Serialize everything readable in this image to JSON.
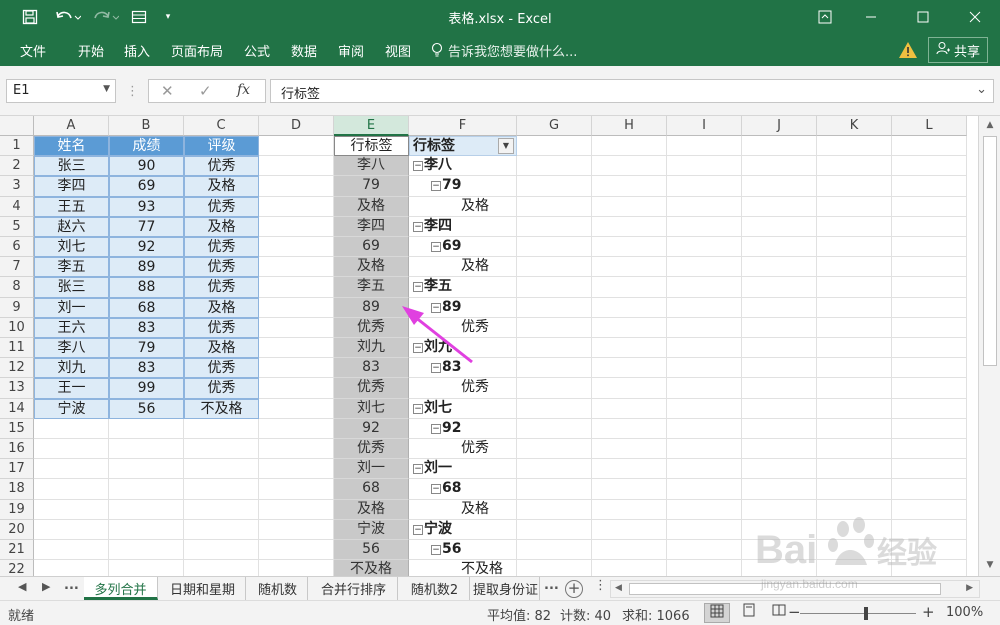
{
  "window": {
    "title": "表格.xlsx - Excel",
    "qa_icons": [
      "save-icon",
      "undo-icon",
      "redo-icon",
      "form-icon",
      "customize-icon"
    ]
  },
  "menu": {
    "items": [
      "文件",
      "开始",
      "插入",
      "页面布局",
      "公式",
      "数据",
      "审阅",
      "视图"
    ],
    "tell_me": "告诉我您想要做什么...",
    "share": "共享"
  },
  "formula_bar": {
    "name_box": "E1",
    "fx": "fx",
    "value": "行标签"
  },
  "columns": [
    "A",
    "B",
    "C",
    "D",
    "E",
    "F",
    "G",
    "H",
    "I",
    "J",
    "K",
    "L"
  ],
  "selected_column": "E",
  "rows": [
    "1",
    "2",
    "3",
    "4",
    "5",
    "6",
    "7",
    "8",
    "9",
    "10",
    "11",
    "12",
    "13",
    "14",
    "15",
    "16",
    "17",
    "18",
    "19",
    "20",
    "21",
    "22"
  ],
  "table": {
    "headers": [
      "姓名",
      "成绩",
      "评级"
    ],
    "rows": [
      [
        "张三",
        "90",
        "优秀"
      ],
      [
        "李四",
        "69",
        "及格"
      ],
      [
        "王五",
        "93",
        "优秀"
      ],
      [
        "赵六",
        "77",
        "及格"
      ],
      [
        "刘七",
        "92",
        "优秀"
      ],
      [
        "李五",
        "89",
        "优秀"
      ],
      [
        "张三",
        "88",
        "优秀"
      ],
      [
        "刘一",
        "68",
        "及格"
      ],
      [
        "王六",
        "83",
        "优秀"
      ],
      [
        "李八",
        "79",
        "及格"
      ],
      [
        "刘九",
        "83",
        "优秀"
      ],
      [
        "王一",
        "99",
        "优秀"
      ],
      [
        "宁波",
        "56",
        "不及格"
      ]
    ]
  },
  "column_e": [
    "行标签",
    "李八",
    "79",
    "及格",
    "李四",
    "69",
    "及格",
    "李五",
    "89",
    "优秀",
    "刘九",
    "83",
    "优秀",
    "刘七",
    "92",
    "优秀",
    "刘一",
    "68",
    "及格",
    "宁波",
    "56",
    "不及格"
  ],
  "pivot": {
    "header": "行标签",
    "rows": [
      {
        "level": 0,
        "text": "李八",
        "toggle": "⊟"
      },
      {
        "level": 1,
        "text": "79",
        "toggle": "⊟"
      },
      {
        "level": 2,
        "text": "及格",
        "toggle": ""
      },
      {
        "level": 0,
        "text": "李四",
        "toggle": "⊟"
      },
      {
        "level": 1,
        "text": "69",
        "toggle": "⊟"
      },
      {
        "level": 2,
        "text": "及格",
        "toggle": ""
      },
      {
        "level": 0,
        "text": "李五",
        "toggle": "⊟"
      },
      {
        "level": 1,
        "text": "89",
        "toggle": "⊟"
      },
      {
        "level": 2,
        "text": "优秀",
        "toggle": ""
      },
      {
        "level": 0,
        "text": "刘九",
        "toggle": "⊟"
      },
      {
        "level": 1,
        "text": "83",
        "toggle": "⊟"
      },
      {
        "level": 2,
        "text": "优秀",
        "toggle": ""
      },
      {
        "level": 0,
        "text": "刘七",
        "toggle": "⊟"
      },
      {
        "level": 1,
        "text": "92",
        "toggle": "⊟"
      },
      {
        "level": 2,
        "text": "优秀",
        "toggle": ""
      },
      {
        "level": 0,
        "text": "刘一",
        "toggle": "⊟"
      },
      {
        "level": 1,
        "text": "68",
        "toggle": "⊟"
      },
      {
        "level": 2,
        "text": "及格",
        "toggle": ""
      },
      {
        "level": 0,
        "text": "宁波",
        "toggle": "⊟"
      },
      {
        "level": 1,
        "text": "56",
        "toggle": "⊟"
      },
      {
        "level": 2,
        "text": "不及格",
        "toggle": ""
      }
    ]
  },
  "sheet_tabs": [
    "多列合并",
    "日期和星期",
    "随机数",
    "合并行排序",
    "随机数2",
    "提取身份证"
  ],
  "active_sheet": "多列合并",
  "tab_nav": {
    "ellipsis": "...",
    "more": "..."
  },
  "status": {
    "ready": "就绪",
    "average": "平均值: 82",
    "count": "计数: 40",
    "sum": "求和: 1066",
    "zoom": "100%"
  },
  "watermark": {
    "line1": "Bai",
    "line2": "经验",
    "url": "jingyan.baidu.com"
  },
  "colors": {
    "excel_green": "#217346",
    "table_header": "#5b9bd5",
    "table_band": "#ddebf7",
    "arrow": "#e040e0"
  }
}
